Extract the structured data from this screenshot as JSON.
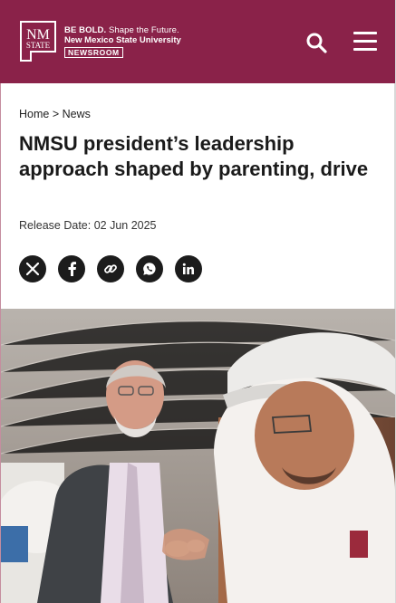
{
  "brand": {
    "mark_top": "NM",
    "mark_bottom": "STATE",
    "tagline_bold": "BE BOLD.",
    "tagline_rest": "Shape the Future.",
    "university": "New Mexico State University",
    "badge": "NEWSROOM"
  },
  "header": {
    "search_icon": "search-icon",
    "menu_icon": "hamburger-menu-icon"
  },
  "breadcrumb": {
    "home": "Home",
    "separator": ">",
    "current": "News"
  },
  "article": {
    "title": "NMSU president’s leadership approach shaped by parenting, drive",
    "release_label": "Release Date:",
    "release_date": "02 Jun 2025"
  },
  "share": {
    "icons": [
      "x-icon",
      "facebook-icon",
      "link-icon",
      "whatsapp-icon",
      "linkedin-icon"
    ]
  },
  "colors": {
    "brand_crimson": "#8a2249",
    "icon_dark": "#1c1c1c"
  }
}
